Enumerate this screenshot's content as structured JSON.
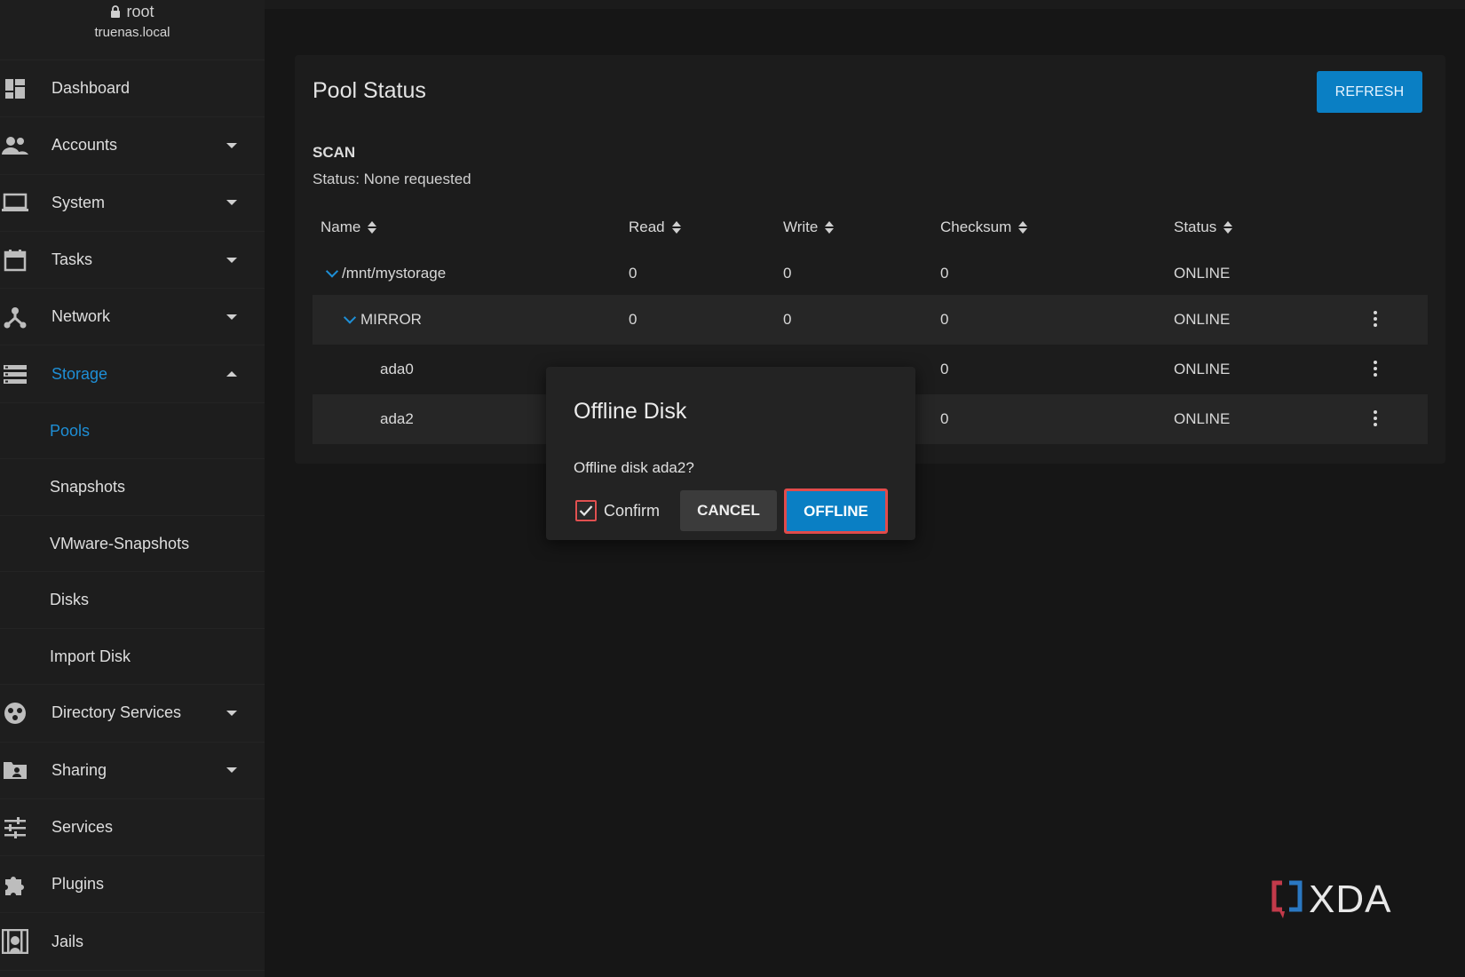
{
  "user": {
    "name": "root",
    "host": "truenas.local",
    "icon": "lock-icon"
  },
  "sidebar": {
    "items": [
      {
        "label": "Dashboard",
        "icon": "dashboard-icon"
      },
      {
        "label": "Accounts",
        "icon": "people-icon"
      },
      {
        "label": "System",
        "icon": "laptop-icon"
      },
      {
        "label": "Tasks",
        "icon": "calendar-icon"
      },
      {
        "label": "Network",
        "icon": "network-icon"
      },
      {
        "label": "Storage",
        "icon": "storage-icon"
      },
      {
        "label": "Directory Services",
        "icon": "directory-services-icon"
      },
      {
        "label": "Sharing",
        "icon": "folder-share-icon"
      },
      {
        "label": "Services",
        "icon": "sliders-icon"
      },
      {
        "label": "Plugins",
        "icon": "puzzle-icon"
      },
      {
        "label": "Jails",
        "icon": "jail-icon"
      }
    ],
    "storage_sub": [
      {
        "label": "Pools"
      },
      {
        "label": "Snapshots"
      },
      {
        "label": "VMware-Snapshots"
      },
      {
        "label": "Disks"
      },
      {
        "label": "Import Disk"
      }
    ]
  },
  "pool": {
    "title": "Pool Status",
    "refresh_label": "REFRESH",
    "scan_title": "SCAN",
    "scan_status": "Status: None requested",
    "columns": [
      "Name",
      "Read",
      "Write",
      "Checksum",
      "Status"
    ],
    "rows": [
      {
        "name": "/mnt/mystorage",
        "read": "0",
        "write": "0",
        "checksum": "0",
        "status": "ONLINE"
      },
      {
        "name": "MIRROR",
        "read": "0",
        "write": "0",
        "checksum": "0",
        "status": "ONLINE"
      },
      {
        "name": "ada0",
        "read": "",
        "write": "",
        "checksum": "0",
        "status": "ONLINE"
      },
      {
        "name": "ada2",
        "read": "",
        "write": "",
        "checksum": "0",
        "status": "ONLINE"
      }
    ]
  },
  "dialog": {
    "title": "Offline Disk",
    "message": "Offline disk ada2?",
    "confirm_label": "Confirm",
    "confirm_checked": true,
    "cancel_label": "CANCEL",
    "offline_label": "OFFLINE"
  },
  "watermark": {
    "text": "XDA"
  },
  "colors": {
    "accent": "#0a7fc4",
    "active_link": "#1e8fd6",
    "highlight": "#e24b4b",
    "background": "#161616",
    "sidebar": "#1e1e1e"
  }
}
